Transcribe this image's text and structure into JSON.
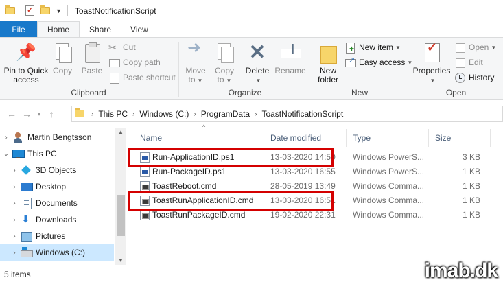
{
  "window": {
    "title": "ToastNotificationScript"
  },
  "tabs": [
    {
      "label": "File"
    },
    {
      "label": "Home"
    },
    {
      "label": "Share"
    },
    {
      "label": "View"
    }
  ],
  "ribbon": {
    "clipboard": {
      "label": "Clipboard",
      "pin_label_1": "Pin to Quick",
      "pin_label_2": "access",
      "copy": "Copy",
      "paste": "Paste",
      "cut": "Cut",
      "copy_path": "Copy path",
      "paste_shortcut": "Paste shortcut"
    },
    "organize": {
      "label": "Organize",
      "move_to_1": "Move",
      "move_to_2": "to",
      "copy_to_1": "Copy",
      "copy_to_2": "to",
      "delete": "Delete",
      "rename": "Rename"
    },
    "new": {
      "label": "New",
      "new_folder_1": "New",
      "new_folder_2": "folder",
      "new_item": "New item",
      "easy_access": "Easy access"
    },
    "open": {
      "label": "Open",
      "properties": "Properties",
      "open": "Open",
      "edit": "Edit",
      "history": "History"
    }
  },
  "address": {
    "crumbs": [
      "This PC",
      "Windows (C:)",
      "ProgramData",
      "ToastNotificationScript"
    ]
  },
  "nav": {
    "items": [
      {
        "label": "Martin Bengtsson",
        "icon": "person-icon"
      },
      {
        "label": "This PC",
        "icon": "computer-icon"
      },
      {
        "label": "3D Objects",
        "icon": "cube-icon"
      },
      {
        "label": "Desktop",
        "icon": "desktop-icon"
      },
      {
        "label": "Documents",
        "icon": "documents-icon"
      },
      {
        "label": "Downloads",
        "icon": "download-icon"
      },
      {
        "label": "Pictures",
        "icon": "pictures-icon"
      },
      {
        "label": "Windows (C:)",
        "icon": "drive-icon"
      }
    ]
  },
  "filelist": {
    "columns": {
      "name": "Name",
      "date": "Date modified",
      "type": "Type",
      "size": "Size"
    },
    "rows": [
      {
        "name": "Run-ApplicationID.ps1",
        "date": "13-03-2020 14:50",
        "type": "Windows PowerS...",
        "size": "3 KB",
        "kind": "ps1",
        "highlighted": true
      },
      {
        "name": "Run-PackageID.ps1",
        "date": "13-03-2020 16:55",
        "type": "Windows PowerS...",
        "size": "1 KB",
        "kind": "ps1",
        "highlighted": false
      },
      {
        "name": "ToastReboot.cmd",
        "date": "28-05-2019 13:49",
        "type": "Windows Comma...",
        "size": "1 KB",
        "kind": "cmd",
        "highlighted": false
      },
      {
        "name": "ToastRunApplicationID.cmd",
        "date": "13-03-2020 16:51",
        "type": "Windows Comma...",
        "size": "1 KB",
        "kind": "cmd",
        "highlighted": true
      },
      {
        "name": "ToastRunPackageID.cmd",
        "date": "19-02-2020 22:31",
        "type": "Windows Comma...",
        "size": "1 KB",
        "kind": "cmd",
        "highlighted": false
      }
    ]
  },
  "status": {
    "items_count": "5 items"
  },
  "watermark": "imab.dk",
  "colors": {
    "accent": "#1979ca",
    "highlight_box": "#d40000",
    "selected_nav": "#cce8ff"
  }
}
